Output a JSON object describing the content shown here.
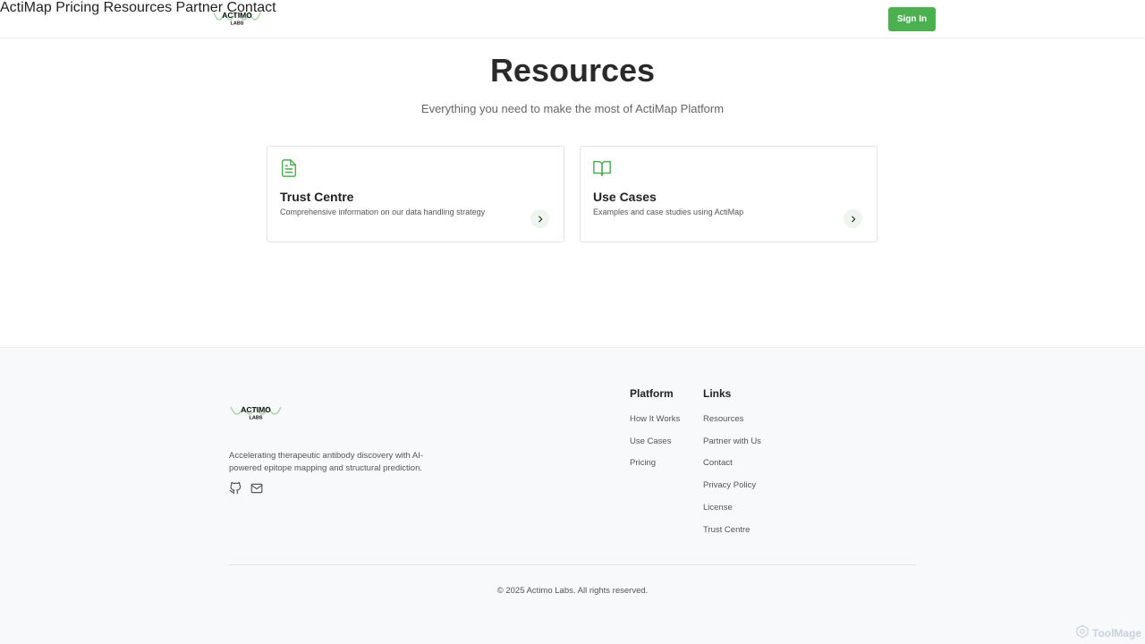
{
  "header": {
    "logo_text": "ACTIMO LABS",
    "nav": [
      {
        "label": "ActiMap"
      },
      {
        "label": "Pricing"
      },
      {
        "label": "Resources"
      },
      {
        "label": "Partner"
      },
      {
        "label": "Contact"
      }
    ],
    "signin_label": "Sign In"
  },
  "hero": {
    "title": "Resources",
    "subtitle": "Everything you need to make the most of ActiMap Platform"
  },
  "cards": [
    {
      "icon": "document-icon",
      "title": "Trust Centre",
      "description": "Comprehensive information on our data handling strategy"
    },
    {
      "icon": "book-open-icon",
      "title": "Use Cases",
      "description": "Examples and case studies using ActiMap"
    }
  ],
  "footer": {
    "tagline": "Accelerating therapeutic antibody discovery with AI-powered epitope mapping and structural prediction.",
    "platform": {
      "heading": "Platform",
      "links": [
        "How It Works",
        "Use Cases",
        "Pricing"
      ]
    },
    "links": {
      "heading": "Links",
      "links": [
        "Resources",
        "Partner with Us",
        "Contact",
        "Privacy Policy",
        "License",
        "Trust Centre"
      ]
    },
    "copyright": "© 2025 Actimo Labs. All rights reserved."
  },
  "watermark": "ToolMage",
  "colors": {
    "accent": "#4caf50",
    "icon": "#4caf50",
    "text_dark": "#222222",
    "text_muted": "#555555",
    "footer_bg": "#f8f9fa"
  }
}
